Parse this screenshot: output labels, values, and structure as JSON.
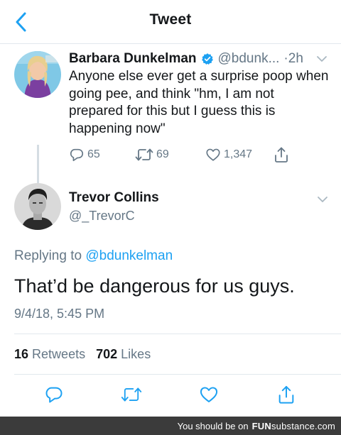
{
  "nav": {
    "title": "Tweet",
    "back_icon": "chevron-left-icon"
  },
  "colors": {
    "accent": "#1da1f2",
    "muted": "#657786",
    "text": "#14171a",
    "divider": "#e1e8ed"
  },
  "parent_tweet": {
    "name": "Barbara Dunkelman",
    "handle": "@bdunk...",
    "separator": "·",
    "time": "2h",
    "verified_icon": "verified-badge-icon",
    "text": "Anyone else ever get a surprise poop when going pee, and think \"hm, I am not prepared for this but I guess this is happening now\"",
    "replies": "65",
    "retweets": "69",
    "likes": "1,347"
  },
  "focus_tweet": {
    "name": "Trevor Collins",
    "handle": "@_TrevorC",
    "replying_prefix": "Replying to",
    "replying_to": "@bdunkelman",
    "text": "That’d be dangerous for us guys.",
    "timestamp": "9/4/18, 5:45 PM",
    "retweet_count": "16",
    "retweet_label": "Retweets",
    "like_count": "702",
    "like_label": "Likes"
  },
  "watermark": {
    "text": "You should be on",
    "brand_fun": "FUN",
    "brand_rest": "substance.com"
  }
}
